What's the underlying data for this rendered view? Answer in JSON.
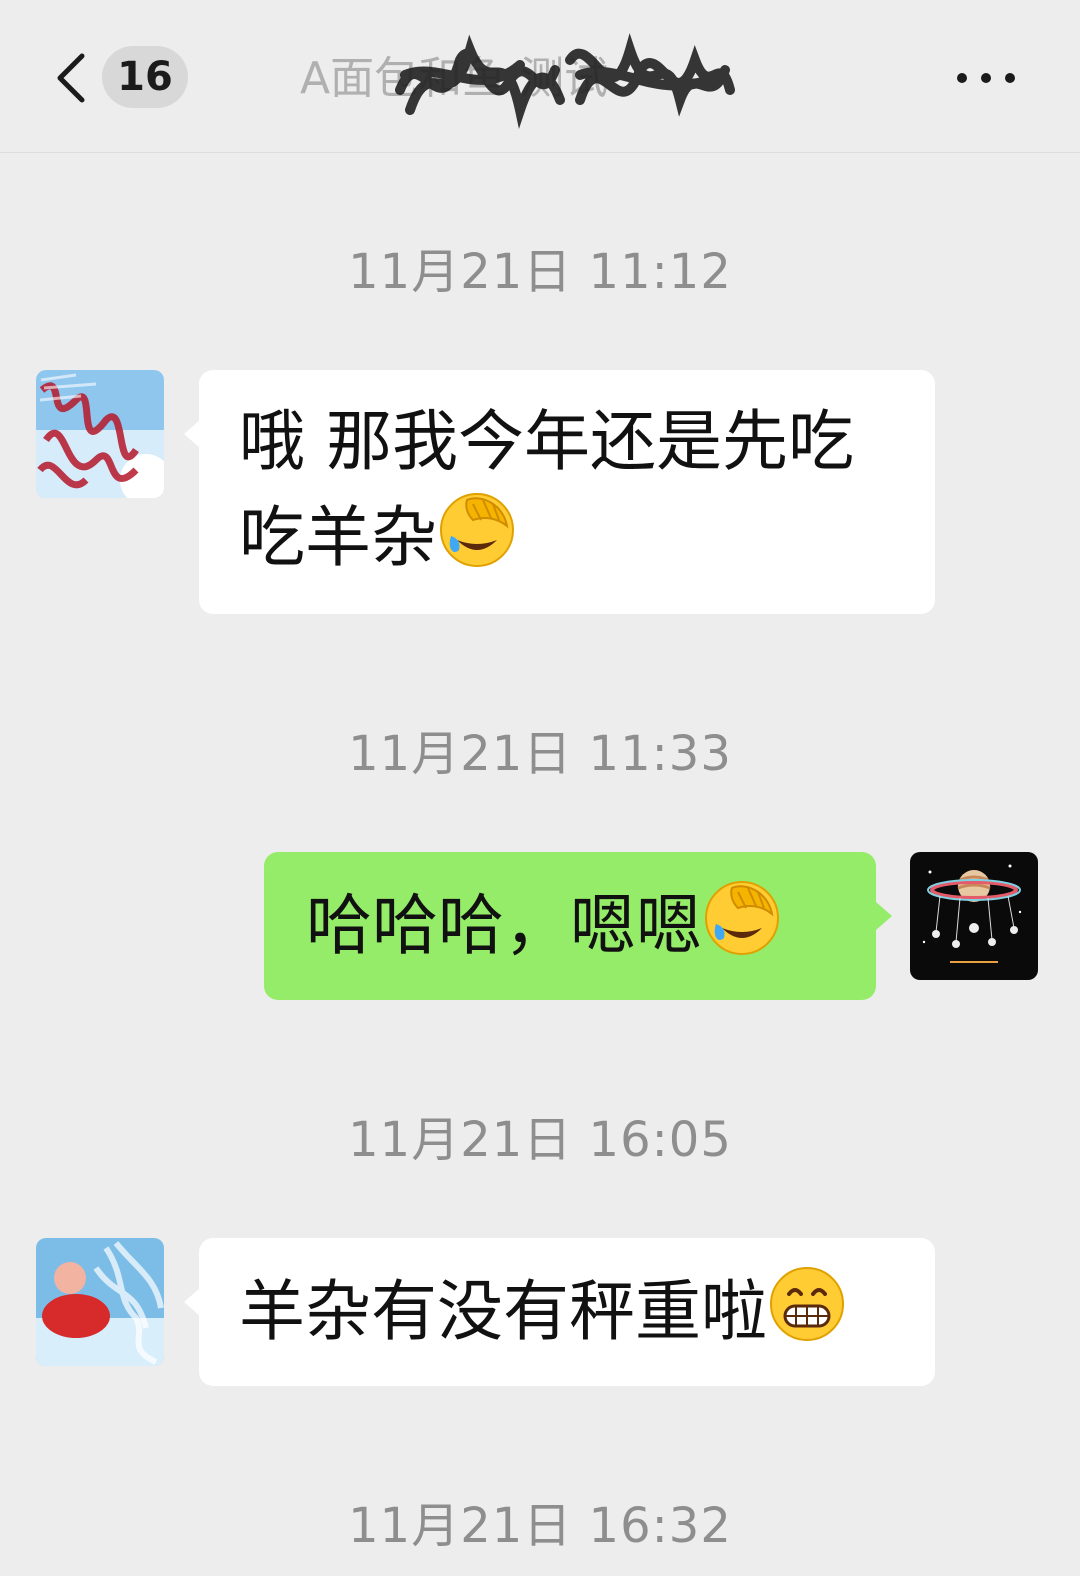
{
  "header": {
    "unread_count": "16",
    "title": "A面包和鱼 测试"
  },
  "messages": [
    {
      "type": "time",
      "text": "11月21日 11:12"
    },
    {
      "type": "incoming",
      "line1": "哦 那我今年还是先吃",
      "line2": "吃羊杂",
      "emoji": "laughing-facepalm-icon"
    },
    {
      "type": "time",
      "text": "11月21日 11:33"
    },
    {
      "type": "outgoing",
      "text": "哈哈哈，嗯嗯",
      "emoji": "laughing-facepalm-icon"
    },
    {
      "type": "time",
      "text": "11月21日 16:05"
    },
    {
      "type": "incoming",
      "text": "羊杂有没有秤重啦",
      "emoji": "grinning-face-icon"
    },
    {
      "type": "time",
      "text": "11月21日 16:32"
    }
  ],
  "colors": {
    "background": "#ededed",
    "incoming_bubble": "#ffffff",
    "outgoing_bubble": "#95ec69",
    "timestamp": "#8e8e8e"
  }
}
